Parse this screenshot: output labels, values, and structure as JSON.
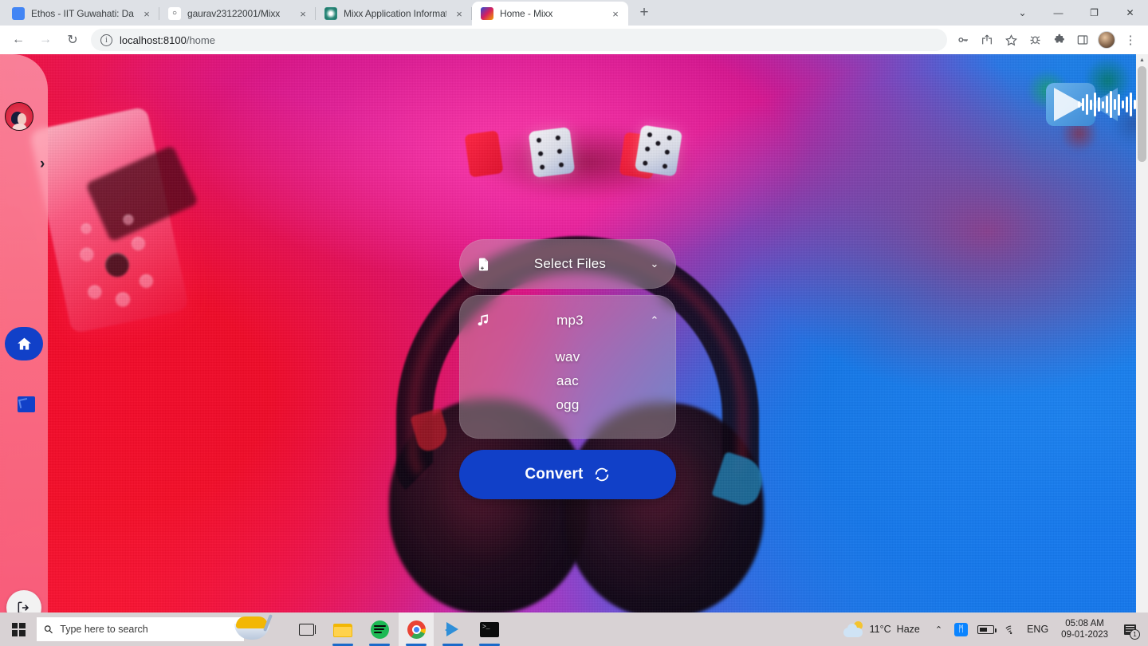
{
  "browser": {
    "tabs": [
      {
        "title": "Ethos - IIT Guwahati: Dashboard",
        "favicon": "ethos-icon",
        "active": false
      },
      {
        "title": "gaurav23122001/Mixx",
        "favicon": "github-icon",
        "active": false
      },
      {
        "title": "Mixx Application Information",
        "favicon": "mixx-info-icon",
        "active": false
      },
      {
        "title": "Home - Mixx",
        "favicon": "mixx-icon",
        "active": true
      }
    ],
    "close_label": "×",
    "new_tab_label": "+",
    "window_controls": {
      "tab_search": "⌄",
      "minimize": "—",
      "maximize": "❐",
      "close": "✕"
    },
    "nav": {
      "back": "←",
      "forward": "→",
      "reload": "↻"
    },
    "omnibox": {
      "info_glyph": "i",
      "host": "localhost:8100",
      "path": "/home",
      "full_url": "localhost:8100/home"
    },
    "toolbar_icons": [
      {
        "name": "password-key-icon",
        "glyph": "✓"
      },
      {
        "name": "share-icon",
        "glyph": "⤴"
      },
      {
        "name": "bookmark-star-icon",
        "glyph": "☆"
      },
      {
        "name": "bug-extension-icon",
        "glyph": "✦"
      },
      {
        "name": "extensions-puzzle-icon",
        "glyph": "❖"
      },
      {
        "name": "side-panel-icon",
        "glyph": "▧"
      },
      {
        "name": "profile-avatar",
        "glyph": ""
      },
      {
        "name": "chrome-menu-icon",
        "glyph": "⋮"
      }
    ]
  },
  "page": {
    "app_logo_name": "mixx-waveform-logo",
    "sidebar": {
      "avatar_name": "user-avatar",
      "expand_glyph": "›",
      "items": [
        {
          "name": "home-button",
          "icon": "home-icon"
        },
        {
          "name": "broken-image-icon",
          "icon": "broken-image-icon"
        }
      ],
      "logout_name": "logout-button",
      "logout_glyph": "↪"
    },
    "converter": {
      "file_row": {
        "label": "Select Files",
        "lead_icon": "file-add-icon",
        "chevron": "⌄"
      },
      "format_row": {
        "selected": "mp3",
        "lead_icon": "music-note-icon",
        "chevron": "⌃"
      },
      "format_options": [
        "wav",
        "aac",
        "ogg"
      ],
      "convert_label": "Convert",
      "convert_icon": "refresh-icon",
      "accent_color": "#1140c8"
    }
  },
  "taskbar": {
    "start_name": "start-button",
    "search": {
      "placeholder": "Type here to search",
      "icon": "search-icon"
    },
    "apps": [
      {
        "name": "task-view-button",
        "label": "Task View",
        "active": false,
        "running": false
      },
      {
        "name": "file-explorer-button",
        "label": "File Explorer",
        "active": false,
        "running": true
      },
      {
        "name": "spotify-button",
        "label": "Spotify",
        "active": false,
        "running": true
      },
      {
        "name": "chrome-button",
        "label": "Google Chrome",
        "active": true,
        "running": true
      },
      {
        "name": "vscode-button",
        "label": "Visual Studio Code",
        "active": false,
        "running": true
      },
      {
        "name": "terminal-button",
        "label": "Terminal",
        "active": false,
        "running": true
      }
    ],
    "tray": {
      "weather_temp": "11°C",
      "weather_condition": "Haze",
      "overflow_glyph": "⌃",
      "bluetooth_glyph": "ᛗ",
      "wifi_glyph": "◠",
      "language": "ENG",
      "time": "05:08 AM",
      "date": "09-01-2023",
      "notification_count": "1"
    }
  }
}
